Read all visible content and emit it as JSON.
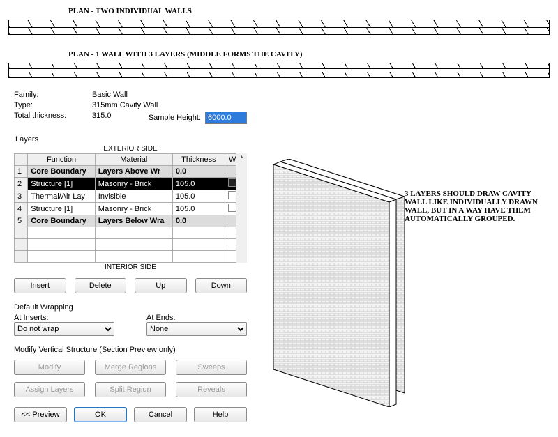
{
  "plan_labels": {
    "two_walls": "PLAN - TWO INDIVIDUAL WALLS",
    "one_wall": "PLAN - 1 WALL WITH 3 LAYERS (MIDDLE FORMS THE CAVITY)"
  },
  "meta": {
    "family_k": "Family:",
    "family_v": "Basic Wall",
    "type_k": "Type:",
    "type_v": "315mm Cavity Wall",
    "thick_k": "Total thickness:",
    "thick_v": "315.0",
    "sample_height_k": "Sample Height:",
    "sample_height_v": "6000.0"
  },
  "layers_title": "Layers",
  "exterior_label": "EXTERIOR SIDE",
  "interior_label": "INTERIOR SIDE",
  "headers": {
    "fn": "Function",
    "mat": "Material",
    "th": "Thickness",
    "wrap": "Wra"
  },
  "rows": [
    {
      "n": "1",
      "fn": "Core Boundary",
      "mat": "Layers Above Wr",
      "th": "0.0",
      "kind": "boundary"
    },
    {
      "n": "2",
      "fn": "Structure [1]",
      "mat": "Masonry - Brick",
      "th": "105.0",
      "kind": "selected"
    },
    {
      "n": "3",
      "fn": "Thermal/Air Lay",
      "mat": "Invisible",
      "th": "105.0",
      "kind": "normal"
    },
    {
      "n": "4",
      "fn": "Structure [1]",
      "mat": "Masonry - Brick",
      "th": "105.0",
      "kind": "normal"
    },
    {
      "n": "5",
      "fn": "Core Boundary",
      "mat": "Layers Below Wra",
      "th": "0.0",
      "kind": "boundary"
    }
  ],
  "btns": {
    "insert": "Insert",
    "delete": "Delete",
    "up": "Up",
    "down": "Down"
  },
  "wrapping": {
    "title": "Default Wrapping",
    "at_inserts_k": "At Inserts:",
    "at_inserts_v": "Do not wrap",
    "at_ends_k": "At Ends:",
    "at_ends_v": "None"
  },
  "modify": {
    "title": "Modify Vertical Structure (Section Preview only)",
    "modify": "Modify",
    "merge": "Merge Regions",
    "sweeps": "Sweeps",
    "assign": "Assign Layers",
    "split": "Split Region",
    "reveals": "Reveals"
  },
  "bottom": {
    "preview": "<< Preview",
    "ok": "OK",
    "cancel": "Cancel",
    "help": "Help"
  },
  "annotation": "3 LAYERS SHOULD DRAW CAVITY WALL LIKE INDIVIDUALLY DRAWN WALL, BUT IN A WAY HAVE THEM AUTOMATICALLY GROUPED."
}
